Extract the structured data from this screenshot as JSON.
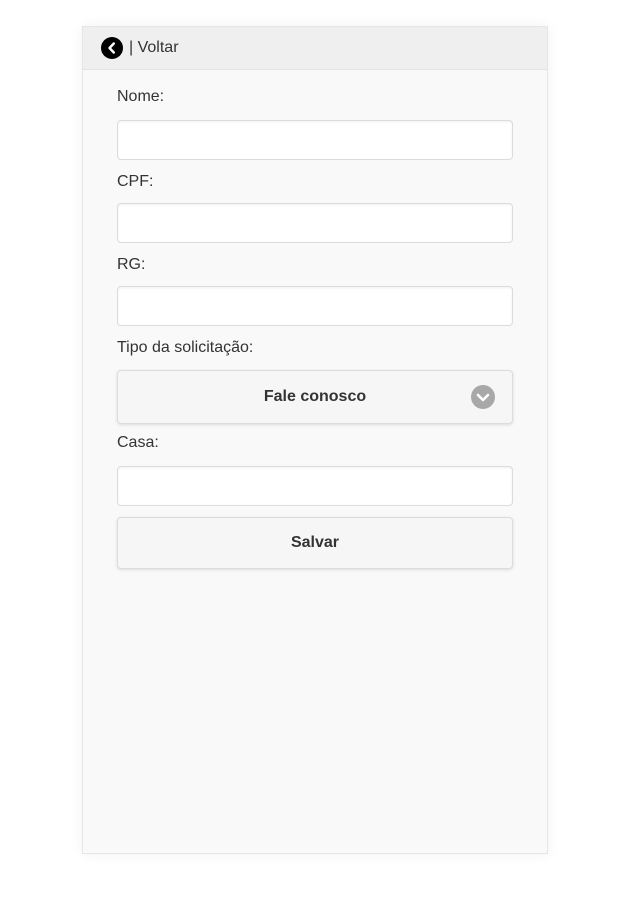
{
  "header": {
    "back_label": "| Voltar",
    "back_icon": "chevron-left-circle-icon"
  },
  "form": {
    "nome_label": "Nome:",
    "nome_value": "",
    "cpf_label": "CPF:",
    "cpf_value": "",
    "rg_label": "RG:",
    "rg_value": "",
    "tipo_label": "Tipo da solicitação:",
    "tipo_value": "Fale conosco",
    "tipo_icon": "chevron-down-circle-icon",
    "casa_label": "Casa:",
    "casa_value": "",
    "save_label": "Salvar"
  },
  "colors": {
    "panel_bg": "#f9f9f9",
    "header_bg": "#efefef",
    "text": "#333333",
    "select_arrow": "#a8a8a8"
  }
}
